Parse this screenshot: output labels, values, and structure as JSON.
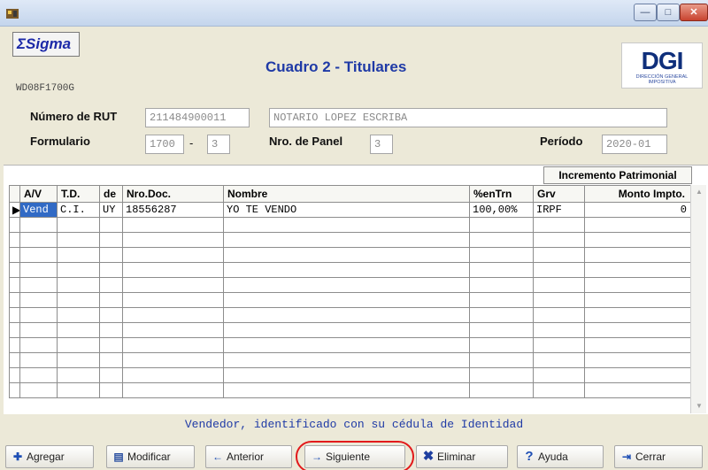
{
  "titlebar": {
    "min_label": "—",
    "max_label": "□",
    "close_label": "✕"
  },
  "header": {
    "logo_text": "ΣSigma",
    "form_code": "WD08F1700G",
    "title": "Cuadro 2 - Titulares",
    "dgi_logo": "DGI",
    "dgi_sub": "DIRECCIÓN GENERAL IMPOSITIVA"
  },
  "info": {
    "rut_label": "Número de RUT",
    "rut_value": "211484900011",
    "name_value": "NOTARIO LOPEZ ESCRIBA",
    "formulario_label": "Formulario",
    "formulario_value": "1700",
    "formulario_dash": "-",
    "formulario_suffix": "3",
    "panel_label": "Nro. de Panel",
    "panel_value": "3",
    "periodo_label": "Período",
    "periodo_value": "2020-01"
  },
  "grid": {
    "group_header": "Incremento Patrimonial",
    "columns": [
      "A/V",
      "T.D.",
      "de",
      "Nro.Doc.",
      "Nombre",
      "%enTrn",
      "Grv",
      "Monto Impto."
    ],
    "rows": [
      [
        "Vend",
        "C.I.",
        "UY",
        "18556287",
        "YO TE VENDO",
        "100,00%",
        "IRPF",
        "0"
      ]
    ],
    "empty_rows": 12
  },
  "status": "Vendedor, identificado con su cédula de Identidad",
  "buttons": {
    "agregar": "Agregar",
    "modificar": "Modificar",
    "anterior": "Anterior",
    "siguiente": "Siguiente",
    "eliminar": "Eliminar",
    "ayuda": "Ayuda",
    "cerrar": "Cerrar"
  },
  "colors": {
    "accent": "#1f3aa6",
    "selection": "#316ac5",
    "highlight": "#e2191b"
  }
}
